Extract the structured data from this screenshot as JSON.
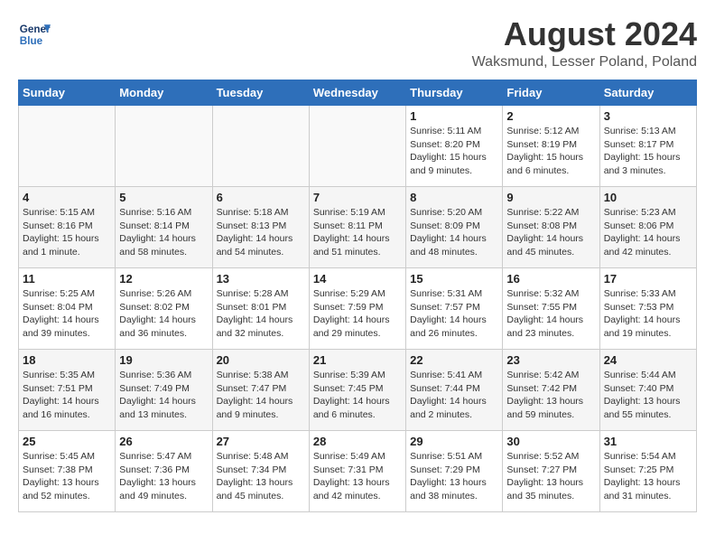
{
  "header": {
    "logo_line1": "General",
    "logo_line2": "Blue",
    "month_year": "August 2024",
    "location": "Waksmund, Lesser Poland, Poland"
  },
  "days_of_week": [
    "Sunday",
    "Monday",
    "Tuesday",
    "Wednesday",
    "Thursday",
    "Friday",
    "Saturday"
  ],
  "weeks": [
    [
      {
        "day": "",
        "info": ""
      },
      {
        "day": "",
        "info": ""
      },
      {
        "day": "",
        "info": ""
      },
      {
        "day": "",
        "info": ""
      },
      {
        "day": "1",
        "info": "Sunrise: 5:11 AM\nSunset: 8:20 PM\nDaylight: 15 hours\nand 9 minutes."
      },
      {
        "day": "2",
        "info": "Sunrise: 5:12 AM\nSunset: 8:19 PM\nDaylight: 15 hours\nand 6 minutes."
      },
      {
        "day": "3",
        "info": "Sunrise: 5:13 AM\nSunset: 8:17 PM\nDaylight: 15 hours\nand 3 minutes."
      }
    ],
    [
      {
        "day": "4",
        "info": "Sunrise: 5:15 AM\nSunset: 8:16 PM\nDaylight: 15 hours\nand 1 minute."
      },
      {
        "day": "5",
        "info": "Sunrise: 5:16 AM\nSunset: 8:14 PM\nDaylight: 14 hours\nand 58 minutes."
      },
      {
        "day": "6",
        "info": "Sunrise: 5:18 AM\nSunset: 8:13 PM\nDaylight: 14 hours\nand 54 minutes."
      },
      {
        "day": "7",
        "info": "Sunrise: 5:19 AM\nSunset: 8:11 PM\nDaylight: 14 hours\nand 51 minutes."
      },
      {
        "day": "8",
        "info": "Sunrise: 5:20 AM\nSunset: 8:09 PM\nDaylight: 14 hours\nand 48 minutes."
      },
      {
        "day": "9",
        "info": "Sunrise: 5:22 AM\nSunset: 8:08 PM\nDaylight: 14 hours\nand 45 minutes."
      },
      {
        "day": "10",
        "info": "Sunrise: 5:23 AM\nSunset: 8:06 PM\nDaylight: 14 hours\nand 42 minutes."
      }
    ],
    [
      {
        "day": "11",
        "info": "Sunrise: 5:25 AM\nSunset: 8:04 PM\nDaylight: 14 hours\nand 39 minutes."
      },
      {
        "day": "12",
        "info": "Sunrise: 5:26 AM\nSunset: 8:02 PM\nDaylight: 14 hours\nand 36 minutes."
      },
      {
        "day": "13",
        "info": "Sunrise: 5:28 AM\nSunset: 8:01 PM\nDaylight: 14 hours\nand 32 minutes."
      },
      {
        "day": "14",
        "info": "Sunrise: 5:29 AM\nSunset: 7:59 PM\nDaylight: 14 hours\nand 29 minutes."
      },
      {
        "day": "15",
        "info": "Sunrise: 5:31 AM\nSunset: 7:57 PM\nDaylight: 14 hours\nand 26 minutes."
      },
      {
        "day": "16",
        "info": "Sunrise: 5:32 AM\nSunset: 7:55 PM\nDaylight: 14 hours\nand 23 minutes."
      },
      {
        "day": "17",
        "info": "Sunrise: 5:33 AM\nSunset: 7:53 PM\nDaylight: 14 hours\nand 19 minutes."
      }
    ],
    [
      {
        "day": "18",
        "info": "Sunrise: 5:35 AM\nSunset: 7:51 PM\nDaylight: 14 hours\nand 16 minutes."
      },
      {
        "day": "19",
        "info": "Sunrise: 5:36 AM\nSunset: 7:49 PM\nDaylight: 14 hours\nand 13 minutes."
      },
      {
        "day": "20",
        "info": "Sunrise: 5:38 AM\nSunset: 7:47 PM\nDaylight: 14 hours\nand 9 minutes."
      },
      {
        "day": "21",
        "info": "Sunrise: 5:39 AM\nSunset: 7:45 PM\nDaylight: 14 hours\nand 6 minutes."
      },
      {
        "day": "22",
        "info": "Sunrise: 5:41 AM\nSunset: 7:44 PM\nDaylight: 14 hours\nand 2 minutes."
      },
      {
        "day": "23",
        "info": "Sunrise: 5:42 AM\nSunset: 7:42 PM\nDaylight: 13 hours\nand 59 minutes."
      },
      {
        "day": "24",
        "info": "Sunrise: 5:44 AM\nSunset: 7:40 PM\nDaylight: 13 hours\nand 55 minutes."
      }
    ],
    [
      {
        "day": "25",
        "info": "Sunrise: 5:45 AM\nSunset: 7:38 PM\nDaylight: 13 hours\nand 52 minutes."
      },
      {
        "day": "26",
        "info": "Sunrise: 5:47 AM\nSunset: 7:36 PM\nDaylight: 13 hours\nand 49 minutes."
      },
      {
        "day": "27",
        "info": "Sunrise: 5:48 AM\nSunset: 7:34 PM\nDaylight: 13 hours\nand 45 minutes."
      },
      {
        "day": "28",
        "info": "Sunrise: 5:49 AM\nSunset: 7:31 PM\nDaylight: 13 hours\nand 42 minutes."
      },
      {
        "day": "29",
        "info": "Sunrise: 5:51 AM\nSunset: 7:29 PM\nDaylight: 13 hours\nand 38 minutes."
      },
      {
        "day": "30",
        "info": "Sunrise: 5:52 AM\nSunset: 7:27 PM\nDaylight: 13 hours\nand 35 minutes."
      },
      {
        "day": "31",
        "info": "Sunrise: 5:54 AM\nSunset: 7:25 PM\nDaylight: 13 hours\nand 31 minutes."
      }
    ]
  ]
}
